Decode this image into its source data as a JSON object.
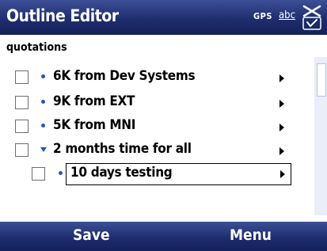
{
  "title_bar": {
    "app_title": "Outline Editor",
    "status_gps": "GPS",
    "status_input": "abc"
  },
  "document": {
    "name": "quotations"
  },
  "outline": {
    "items": [
      {
        "text": "6K from Dev Systems",
        "level": 1,
        "marker": "bullet",
        "checked": false
      },
      {
        "text": "9K from EXT",
        "level": 1,
        "marker": "bullet",
        "checked": false
      },
      {
        "text": "5K from MNI",
        "level": 1,
        "marker": "bullet",
        "checked": false
      },
      {
        "text": "2 months time for all",
        "level": 1,
        "marker": "expanded-triangle",
        "checked": false
      },
      {
        "text": "10 days testing",
        "level": 2,
        "marker": "bullet",
        "checked": false,
        "editing": true
      }
    ]
  },
  "softkeys": {
    "left": "Save",
    "right": "Menu"
  },
  "colors": {
    "bar_dark": "#15215a",
    "bar_light": "#3d4f96",
    "bullet": "#1e56c8",
    "scroll_track": "#e9eef9"
  },
  "icons": {
    "close": "close-ok-icon",
    "row_action": "submenu-arrow-icon",
    "checkbox": "checkbox-icon"
  }
}
